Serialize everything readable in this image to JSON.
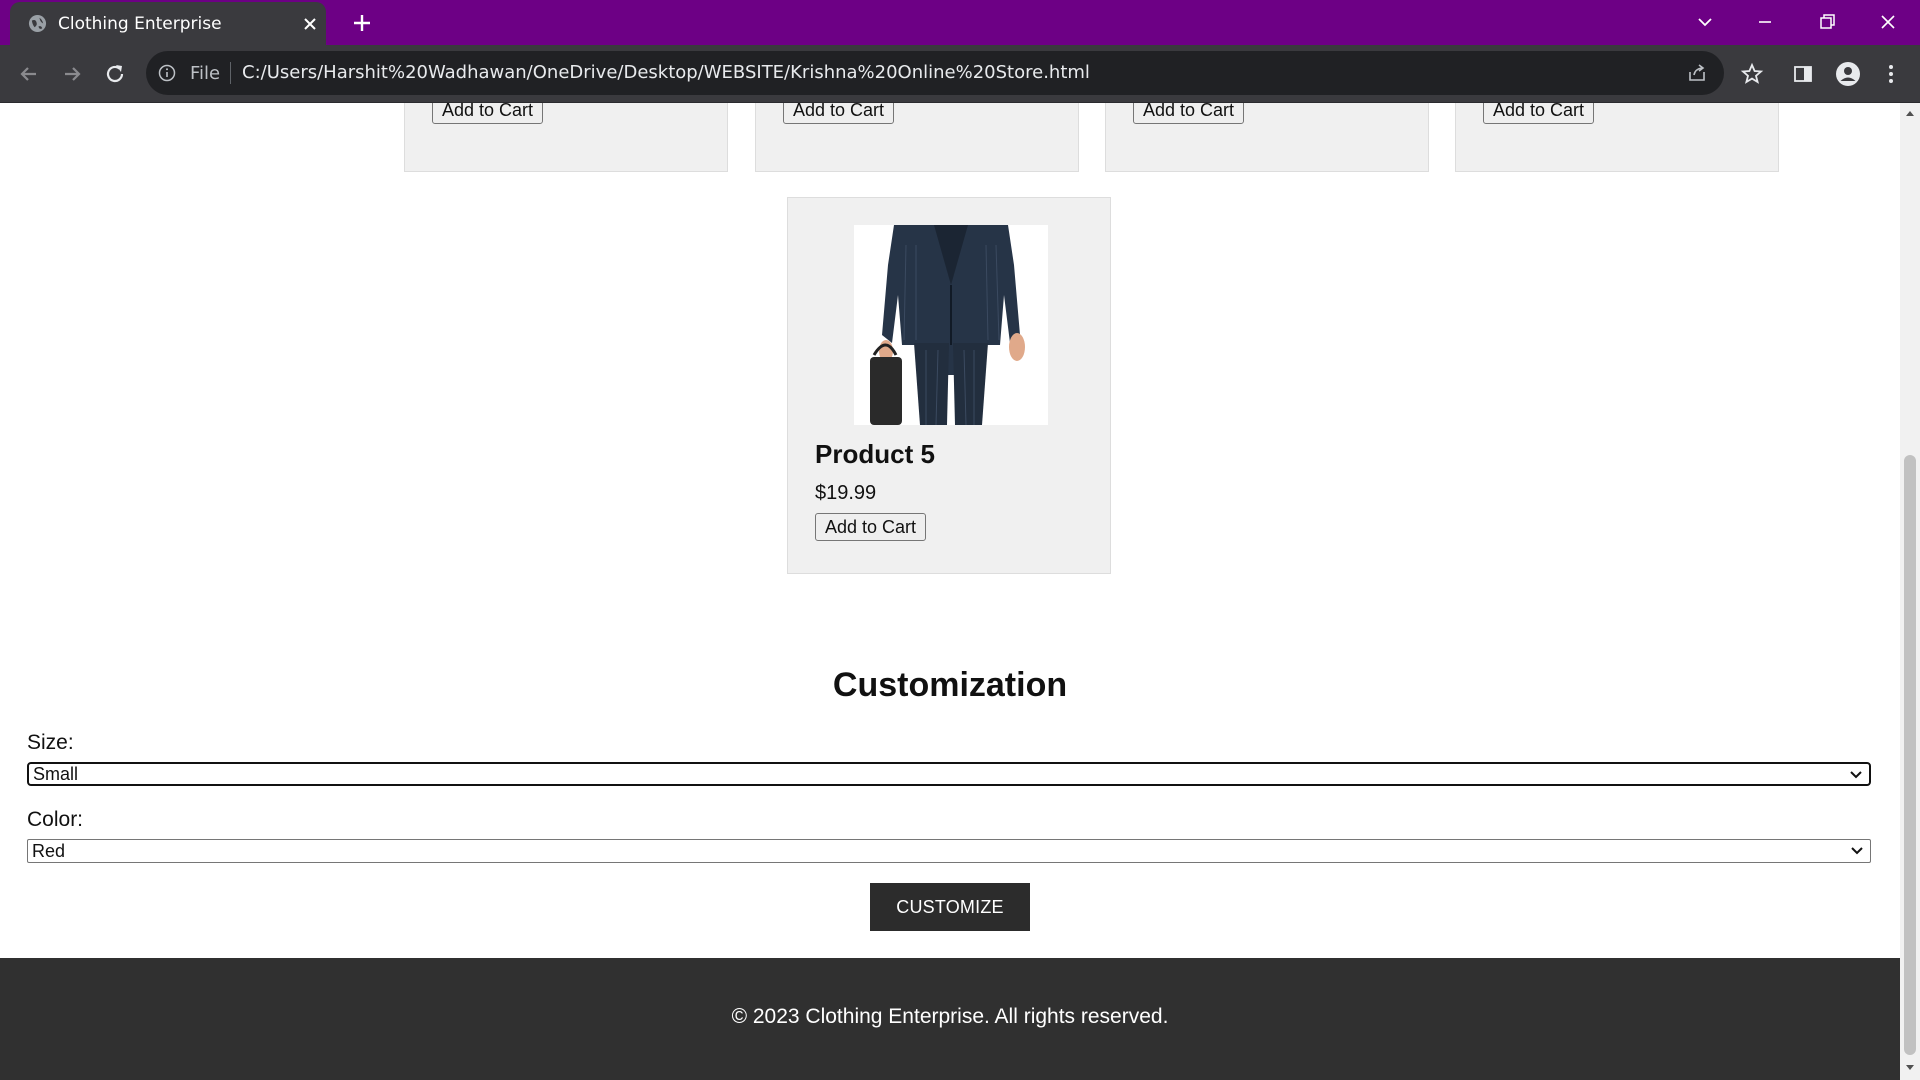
{
  "browser": {
    "tab_title": "Clothing Enterprise",
    "url_scheme_label": "File",
    "url": "C:/Users/Harshit%20Wadhawan/OneDrive/Desktop/WEBSITE/Krishna%20Online%20Store.html",
    "theme_color": "#6d0085",
    "toolbar_color": "#3a3a3e"
  },
  "products_row_top": [
    {
      "button_label": "Add to Cart"
    },
    {
      "button_label": "Add to Cart"
    },
    {
      "button_label": "Add to Cart"
    },
    {
      "button_label": "Add to Cart"
    }
  ],
  "featured_product": {
    "name": "Product 5",
    "price": "$19.99",
    "button_label": "Add to Cart",
    "image_icon": "suit-image"
  },
  "customization": {
    "heading": "Customization",
    "size_label": "Size:",
    "size_value": "Small",
    "color_label": "Color:",
    "color_value": "Red",
    "button_label": "CUSTOMIZE"
  },
  "footer": {
    "copyright": "© 2023 Clothing Enterprise. All rights reserved."
  }
}
